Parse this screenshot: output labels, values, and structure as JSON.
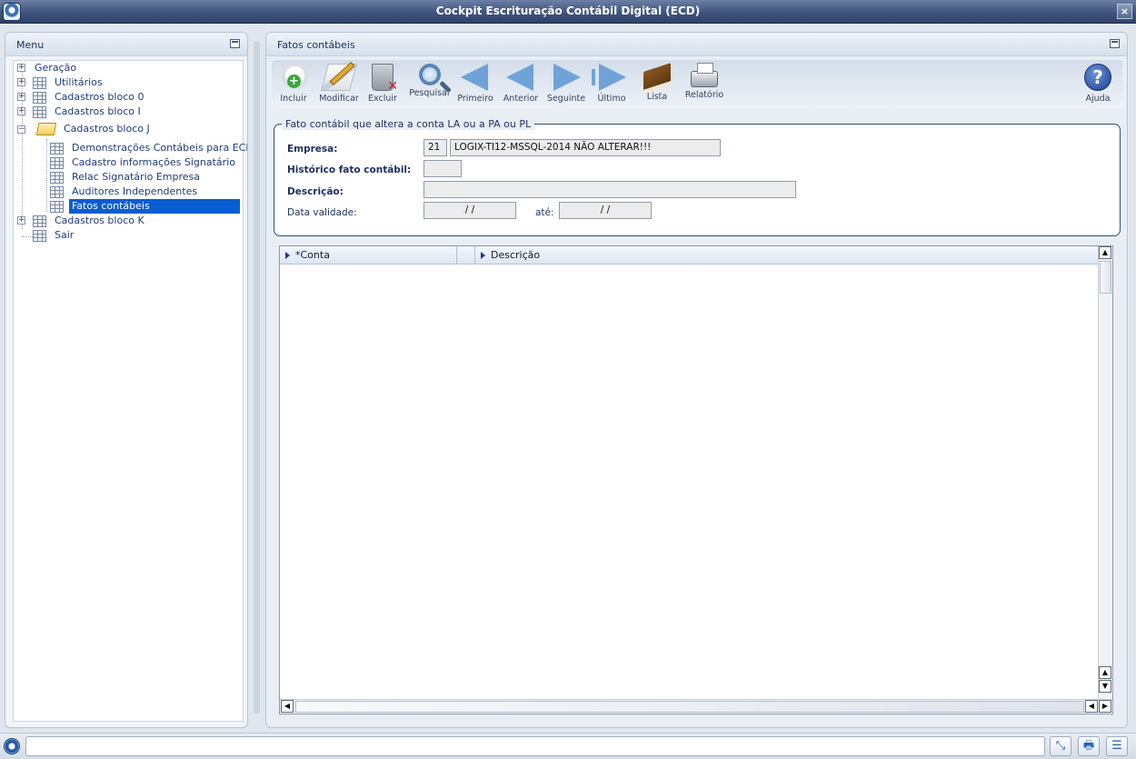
{
  "window": {
    "title": "Cockpit Escrituração Contábil Digital (ECD)",
    "close_label": "×"
  },
  "menu": {
    "title": "Menu",
    "items": [
      {
        "label": "Geração"
      },
      {
        "label": "Utilitários"
      },
      {
        "label": "Cadastros bloco 0"
      },
      {
        "label": "Cadastros bloco I"
      },
      {
        "label": "Cadastros bloco J"
      },
      {
        "label": "Demonstrações Contábeis para ECD"
      },
      {
        "label": "Cadastro informações Signatário"
      },
      {
        "label": "Relac Signatário Empresa"
      },
      {
        "label": "Auditores Independentes"
      },
      {
        "label": "Fatos contábeis"
      },
      {
        "label": "Cadastros bloco K"
      },
      {
        "label": "Sair"
      }
    ],
    "selected": "Fatos contábeis"
  },
  "main": {
    "title": "Fatos contábeis",
    "toolbar": [
      {
        "label": "Incluir",
        "icon": "add-document-icon"
      },
      {
        "label": "Modificar",
        "icon": "edit-document-icon"
      },
      {
        "label": "Excluir",
        "icon": "trash-icon"
      },
      {
        "label": "Pesquisar",
        "icon": "magnifier-icon"
      },
      {
        "label": "Primeiro",
        "icon": "first-arrow-icon"
      },
      {
        "label": "Anterior",
        "icon": "left-arrow-icon"
      },
      {
        "label": "Seguinte",
        "icon": "right-arrow-icon"
      },
      {
        "label": "Último",
        "icon": "last-arrow-icon"
      },
      {
        "label": "Lista",
        "icon": "book-icon"
      },
      {
        "label": "Relatório",
        "icon": "printer-icon"
      },
      {
        "label": "Ajuda",
        "icon": "help-icon"
      }
    ],
    "form": {
      "legend": "Fato contábil que altera a conta LA ou a PA ou PL",
      "empresa_label": "Empresa:",
      "empresa_code": "21",
      "empresa_name": "LOGIX-TI12-MSSQL-2014 NÃO ALTERAR!!!",
      "historico_label": "Histórico fato contábil:",
      "historico_value": "",
      "descricao_label": "Descrição:",
      "descricao_value": "",
      "data_validade_label": "Data validade:",
      "data_validade_value": "/ /",
      "ate_label": "até:",
      "ate_value": "/ /"
    },
    "grid": {
      "columns": [
        "*Conta",
        "Descrição"
      ],
      "rows": []
    }
  },
  "colors": {
    "title_bar": "#3f547d",
    "selection": "#0a5cd2",
    "toolbar_arrow": "#6fa3d8"
  }
}
